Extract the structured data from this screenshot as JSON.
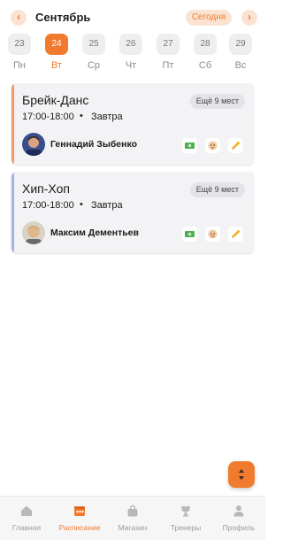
{
  "header": {
    "prev_icon": "chevron-left-icon",
    "next_icon": "chevron-right-icon",
    "month": "Сентябрь",
    "today_label": "Сегодня",
    "accent_color": "#f07b2e"
  },
  "days": [
    {
      "num": "23",
      "name": "Пн",
      "active": false
    },
    {
      "num": "24",
      "name": "Вт",
      "active": true
    },
    {
      "num": "25",
      "name": "Ср",
      "active": false
    },
    {
      "num": "26",
      "name": "Чт",
      "active": false
    },
    {
      "num": "27",
      "name": "Пт",
      "active": false
    },
    {
      "num": "28",
      "name": "Сб",
      "active": false
    },
    {
      "num": "29",
      "name": "Вс",
      "active": false
    }
  ],
  "classes": [
    {
      "title": "Брейк-Данс",
      "time": "17:00-18:00",
      "separator": "•",
      "when": "Завтра",
      "seats": "Ещё 9 мест",
      "trainer": "Геннадий Зыбенко",
      "bar_color": "#f29a6b",
      "icons": [
        "money-icon",
        "baby-icon",
        "pencil-icon"
      ]
    },
    {
      "title": "Хип-Хоп",
      "time": "17:00-18:00",
      "separator": "•",
      "when": "Завтра",
      "seats": "Ещё 9 мест",
      "trainer": "Максим Дементьев",
      "bar_color": "#9eb3e8",
      "icons": [
        "money-icon",
        "baby-icon",
        "pencil-icon"
      ]
    }
  ],
  "fab_icon": "sort-arrows-icon",
  "tabs": [
    {
      "label": "Главная",
      "icon": "home-icon",
      "active": false
    },
    {
      "label": "Расписание",
      "icon": "calendar-icon",
      "active": true
    },
    {
      "label": "Магазин",
      "icon": "shopping-bag-icon",
      "active": false
    },
    {
      "label": "Тренеры",
      "icon": "trainer-icon",
      "active": false
    },
    {
      "label": "Профиль",
      "icon": "user-icon",
      "active": false
    }
  ]
}
